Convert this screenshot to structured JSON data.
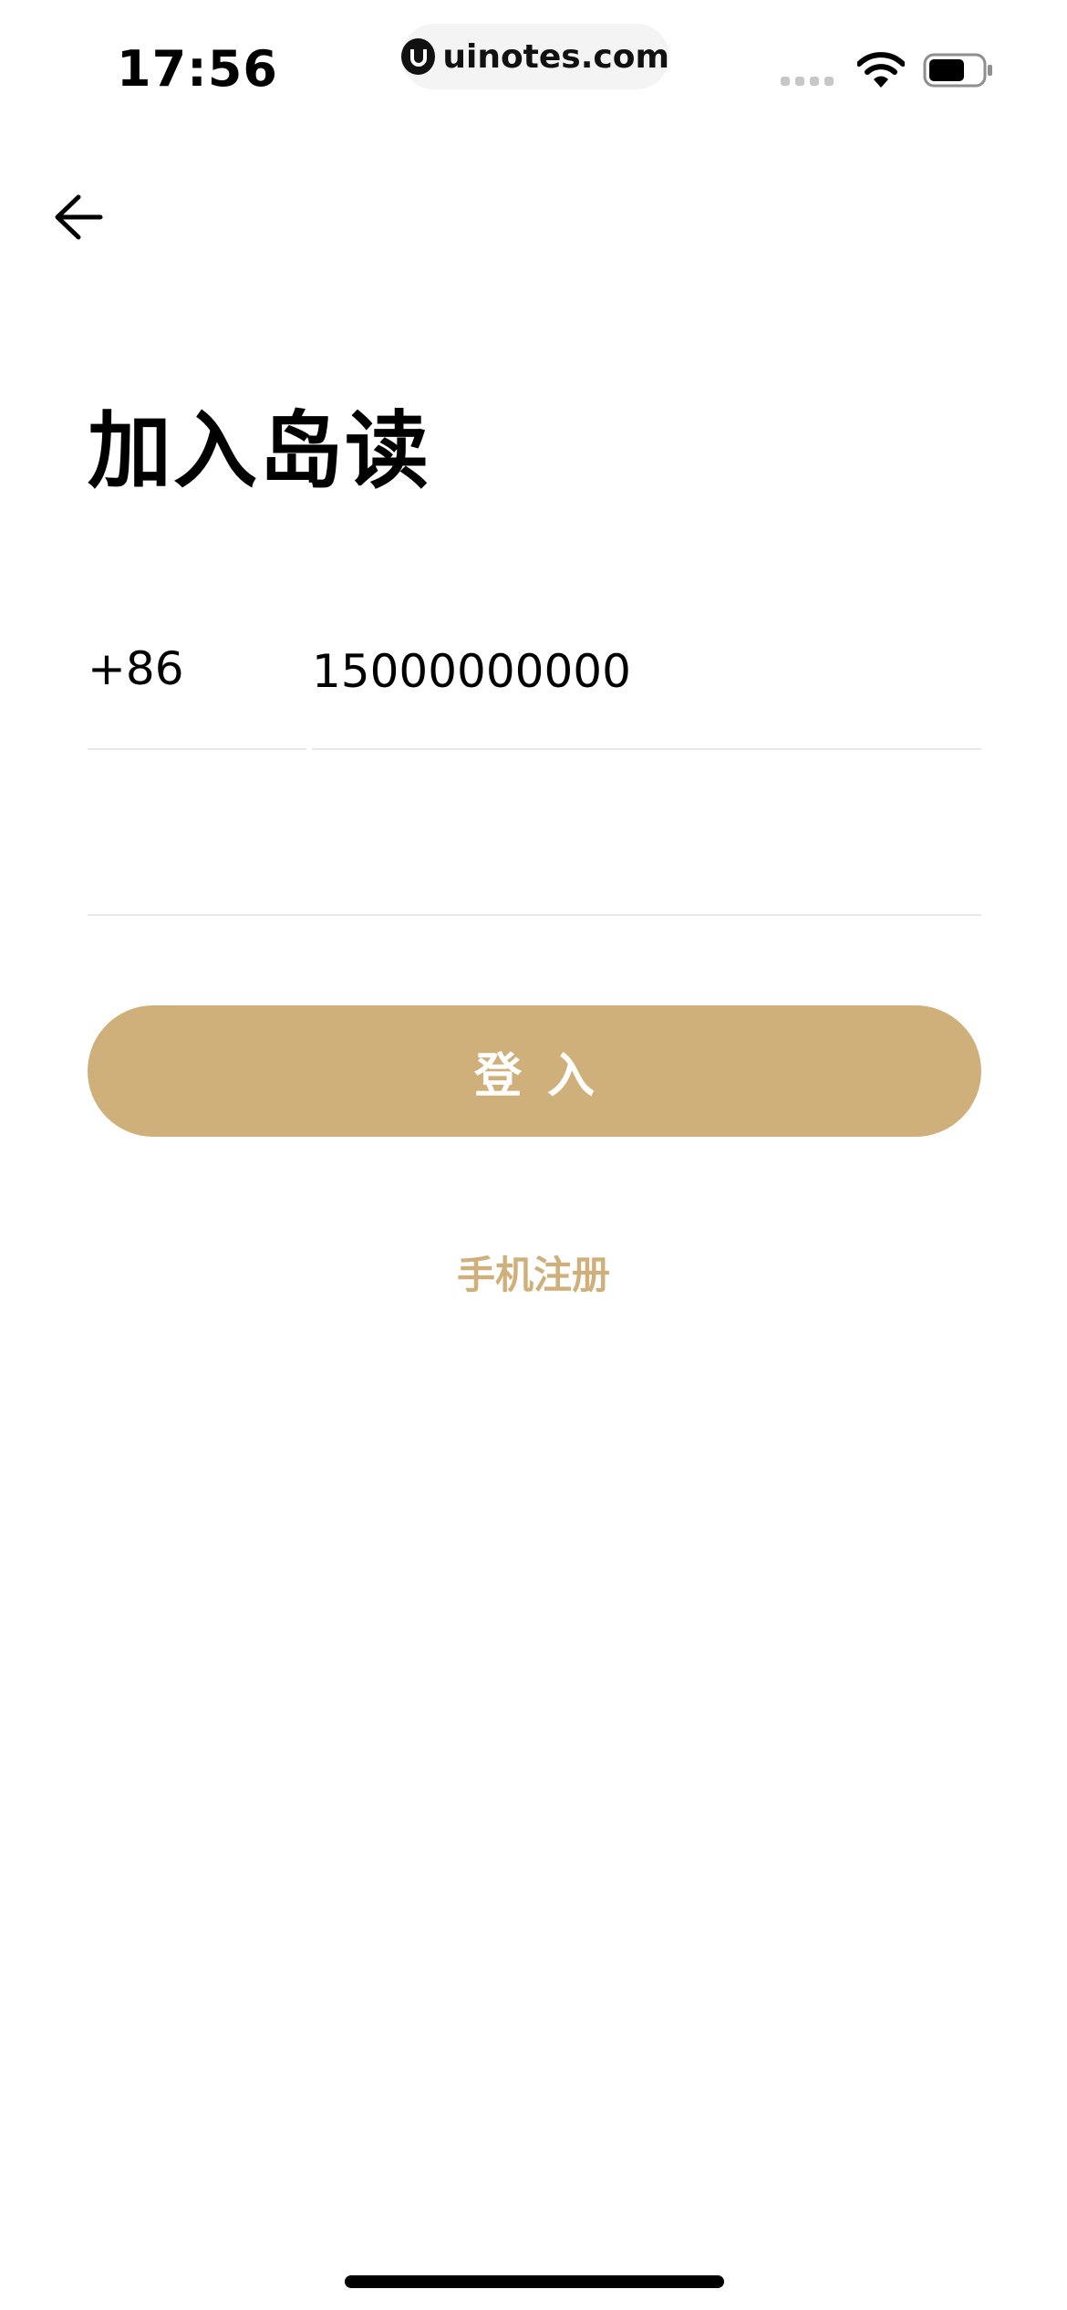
{
  "status_bar": {
    "time": "17:56",
    "watermark": "uinotes.com"
  },
  "page": {
    "title": "加入岛读"
  },
  "form": {
    "country_code": "+86",
    "phone_value": "15000000000",
    "password_value": "",
    "login_label": "登入",
    "register_label": "手机注册"
  },
  "colors": {
    "accent": "#cfb07b",
    "divider": "#e8e8e8"
  },
  "icons": {
    "back": "arrow-left-icon",
    "wifi": "wifi-icon",
    "battery": "battery-icon",
    "signal": "cellular-signal-icon"
  }
}
